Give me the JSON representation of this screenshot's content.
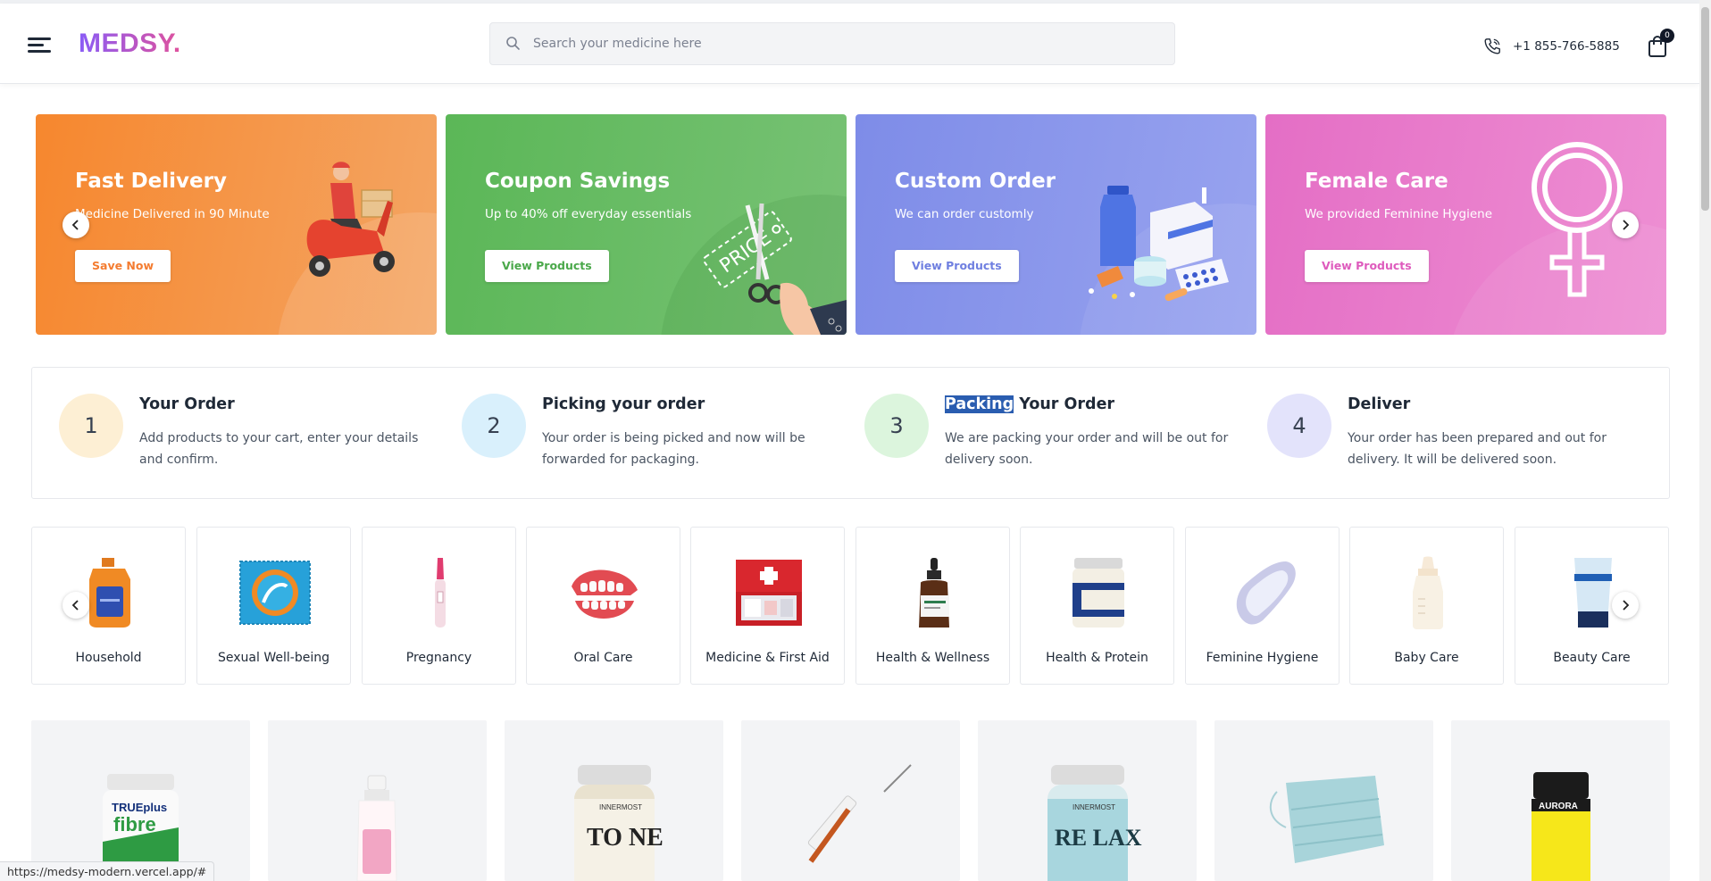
{
  "header": {
    "logo": "MEDSY.",
    "search_placeholder": "Search your medicine here",
    "phone": "+1 855-766-5885",
    "cart_count": "0"
  },
  "banners": [
    {
      "title": "Fast Delivery",
      "subtitle": "Medicine Delivered in 90 Minute",
      "button": "Save Now",
      "accent": "#f47c30"
    },
    {
      "title": "Coupon Savings",
      "subtitle": "Up to 40% off everyday essentials",
      "button": "View Products",
      "accent": "#4aa84a",
      "art_text": "PRICE"
    },
    {
      "title": "Custom Order",
      "subtitle": "We can order customly",
      "button": "View Products",
      "accent": "#6f7fe0"
    },
    {
      "title": "Female Care",
      "subtitle": "We provided Feminine Hygiene",
      "button": "View Products",
      "accent": "#de5bbd"
    }
  ],
  "steps": [
    {
      "number": "1",
      "title": "Your Order",
      "title_highlight": "",
      "description": "Add products to your cart, enter your details and confirm.",
      "color": "#fdefd4"
    },
    {
      "number": "2",
      "title": "Picking your order",
      "title_highlight": "",
      "description": "Your order is being picked and now will be forwarded for packaging.",
      "color": "#d9f0fc"
    },
    {
      "number": "3",
      "title": " Your Order",
      "title_highlight": "Packing",
      "description": "We are packing your order and will be out for delivery soon.",
      "color": "#dcf5dd"
    },
    {
      "number": "4",
      "title": "Deliver",
      "title_highlight": "",
      "description": "Your order has been prepared and out for delivery. It will be delivered soon.",
      "color": "#e3e3fb"
    }
  ],
  "categories": [
    {
      "label": "Household",
      "icon": "detergent-bottle-icon"
    },
    {
      "label": "Sexual Well-being",
      "icon": "condom-pack-icon"
    },
    {
      "label": "Pregnancy",
      "icon": "pregnancy-test-icon"
    },
    {
      "label": "Oral Care",
      "icon": "dentures-icon"
    },
    {
      "label": "Medicine & First Aid",
      "icon": "first-aid-kit-icon"
    },
    {
      "label": "Health & Wellness",
      "icon": "dropper-bottle-icon"
    },
    {
      "label": "Health & Protein",
      "icon": "protein-tub-icon"
    },
    {
      "label": "Feminine Hygiene",
      "icon": "sanitary-pad-icon"
    },
    {
      "label": "Baby Care",
      "icon": "baby-bottle-icon"
    },
    {
      "label": "Beauty Care",
      "icon": "cream-tube-icon"
    }
  ],
  "products": [
    {
      "icon": "fibre-supplement-bottle-icon",
      "label_top": "TRUEplus",
      "label_main": "fibre"
    },
    {
      "icon": "spray-bottle-icon",
      "label_main": ""
    },
    {
      "icon": "tone-capsule-jar-icon",
      "label_main": "TO NE",
      "brand": "INNERMOST"
    },
    {
      "icon": "syringe-icon",
      "label_main": ""
    },
    {
      "icon": "relax-capsule-jar-icon",
      "label_main": "RE LAX",
      "brand": "INNERMOST"
    },
    {
      "icon": "face-mask-icon",
      "label_main": ""
    },
    {
      "icon": "aurora-bottle-icon",
      "label_main": "AURORA"
    }
  ],
  "status_url": "https://medsy-modern.vercel.app/#"
}
